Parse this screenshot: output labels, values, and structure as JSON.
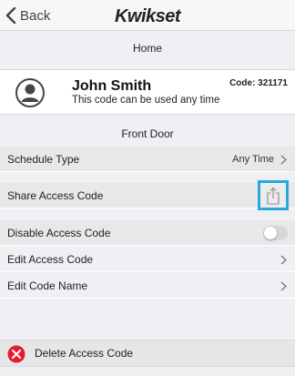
{
  "nav": {
    "back_label": "Back",
    "brand": "Kwikset"
  },
  "home_header": "Home",
  "user": {
    "name": "John Smith",
    "description": "This code can be used any time",
    "code_label": "Code: 321171"
  },
  "door_header": "Front Door",
  "rows": {
    "schedule": {
      "label": "Schedule Type",
      "value": "Any Time"
    },
    "share": {
      "label": "Share Access Code"
    },
    "disable": {
      "label": "Disable Access Code",
      "enabled": false
    },
    "edit_code": {
      "label": "Edit Access Code"
    },
    "edit_name": {
      "label": "Edit Code Name"
    }
  },
  "delete": {
    "label": "Delete Access Code"
  },
  "colors": {
    "highlight": "#29a8df",
    "delete_red": "#e8192c",
    "toggle_off": "#d7d7d7"
  },
  "icons": [
    "chevron-left-icon",
    "user-avatar-icon",
    "chevron-right-icon",
    "share-icon",
    "delete-x-icon"
  ]
}
